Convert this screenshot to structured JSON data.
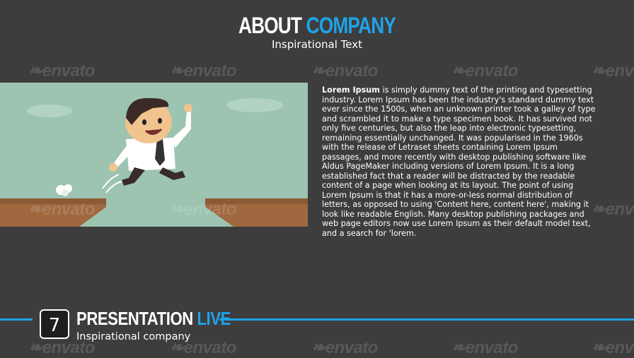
{
  "header": {
    "title_part1": "ABOUT",
    "title_part2": "COMPANY",
    "subtitle": "Inspirational Text"
  },
  "watermark": {
    "text": "envato"
  },
  "content": {
    "lead": "Lorem Ipsum",
    "body": " is simply dummy text of the printing and typesetting industry. Lorem Ipsum has been the industry's standard dummy text ever since the 1500s, when an unknown printer took a galley of type and scrambled it to make a type specimen book. It has survived not only five centuries, but also the leap into electronic typesetting, remaining essentially unchanged. It was popularised in the 1960s with the release of Letraset sheets containing Lorem Ipsum passages, and more recently with desktop publishing software like Aldus PageMaker including versions of Lorem Ipsum. It is a long established fact that a reader will be distracted by the readable content of a page when looking at its layout. The point of using Lorem Ipsum is that it has a more-or-less normal distribution of letters, as opposed to using 'Content here, content here', making it look like readable English. Many desktop publishing packages and web page editors now use Lorem Ipsum as their default model text, and a search for 'lorem."
  },
  "footer": {
    "slide_number": "7",
    "title_part1": "PRESENTATION",
    "title_part2": "LIVE",
    "subtitle": "Inspirational company"
  },
  "colors": {
    "background": "#3d3d3d",
    "accent": "#1fa3e8",
    "illustration_bg": "#9cc4b0",
    "cliff": "#a0683f"
  }
}
